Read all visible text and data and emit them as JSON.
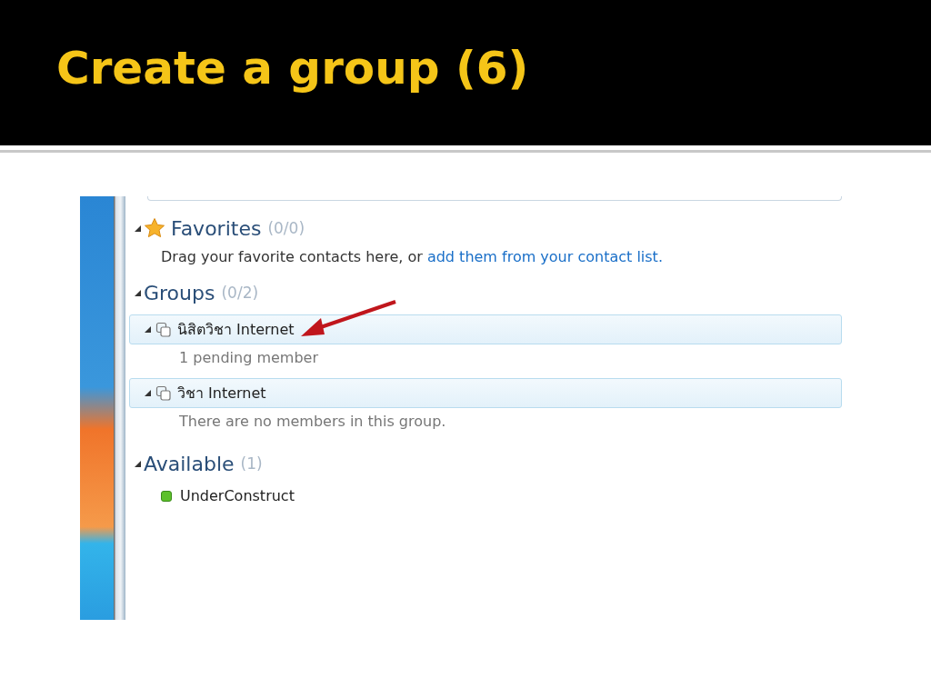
{
  "slide": {
    "title": "Create a group (6)"
  },
  "favorites": {
    "title": "Favorites",
    "count": "(0/0)",
    "expanded": true,
    "hint": "Drag your favorite contacts here, or ",
    "hint_link": "add them from your contact list."
  },
  "groups": {
    "title": "Groups",
    "count": "(0/2)",
    "expanded": true,
    "items": [
      {
        "name": "นิสิตวิชา Internet",
        "expanded": true,
        "detail": "1 pending member"
      },
      {
        "name": "วิชา Internet",
        "expanded": true,
        "detail": "There are no members in this group."
      }
    ]
  },
  "available": {
    "title": "Available",
    "count": "(1)",
    "expanded": true,
    "contacts": [
      {
        "name": "UnderConstruct",
        "color": "#5cc02a"
      }
    ]
  }
}
